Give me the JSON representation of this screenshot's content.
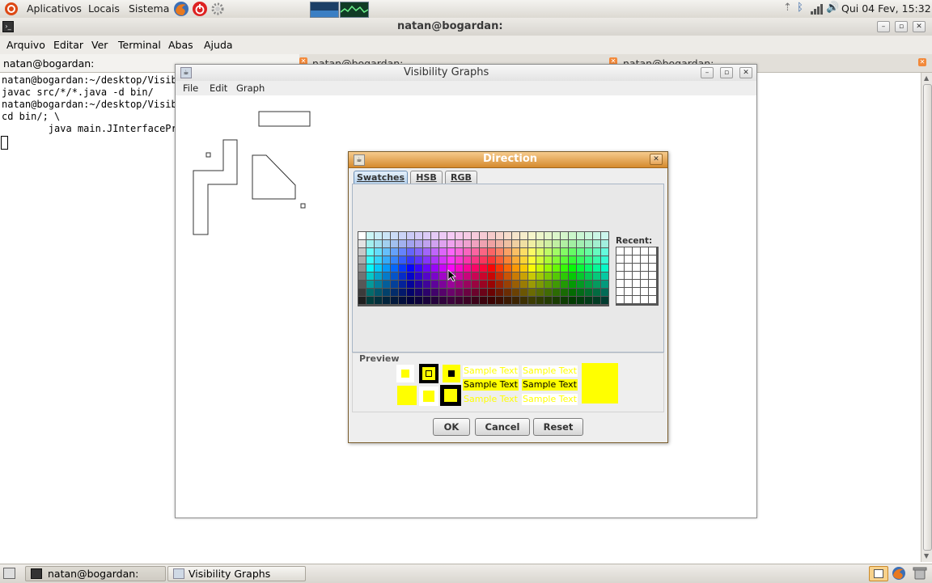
{
  "top_panel": {
    "apps": "Aplicativos",
    "places": "Locais",
    "system": "Sistema",
    "clock": "Qui 04 Fev, 15:32"
  },
  "terminal": {
    "title": "natan@bogardan:",
    "menu": [
      "Arquivo",
      "Editar",
      "Ver",
      "Terminal",
      "Abas",
      "Ajuda"
    ],
    "tabs": [
      "natan@bogardan:",
      "natan@bogardan:",
      "natan@bogardan:"
    ],
    "lines": [
      "natan@bogardan:~/desktop/Visib",
      "javac src/*/*.java -d bin/",
      "natan@bogardan:~/desktop/Visib",
      "cd bin/; \\",
      "        java main.JInterfacePr"
    ]
  },
  "vg_window": {
    "title": "Visibility Graphs",
    "menu": [
      "File",
      "Edit",
      "Graph"
    ]
  },
  "dialog": {
    "title": "Direction",
    "tabs": [
      "Swatches",
      "HSB",
      "RGB"
    ],
    "recent_label": "Recent:",
    "preview_label": "Preview",
    "sample_text": "Sample Text",
    "buttons": {
      "ok": "OK",
      "cancel": "Cancel",
      "reset": "Reset"
    },
    "selected_color": "#ffff00"
  },
  "taskbar": {
    "items": [
      "natan@bogardan:",
      "Visibility Graphs"
    ]
  }
}
